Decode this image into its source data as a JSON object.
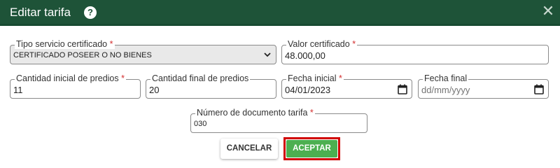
{
  "dialog": {
    "title": "Editar tarifa",
    "help_icon": "?",
    "close_icon": "✕"
  },
  "fields": {
    "tipo_servicio": {
      "label": "Tipo servicio certificado",
      "required": "*",
      "value": "CERTIFICADO POSEER O NO BIENES"
    },
    "valor_certificado": {
      "label": "Valor certificado",
      "required": "*",
      "value": "48.000,00"
    },
    "cantidad_inicial": {
      "label": "Cantidad inicial de predios",
      "required": "*",
      "value": "11"
    },
    "cantidad_final": {
      "label": "Cantidad final de predios",
      "value": "20"
    },
    "fecha_inicial": {
      "label": "Fecha inicial",
      "required": "*",
      "value": "04/01/2023"
    },
    "fecha_final": {
      "label": "Fecha final",
      "placeholder": "dd/mm/yyyy"
    },
    "numero_documento": {
      "label": "Número de documento tarifa",
      "required": "*",
      "value": "030"
    }
  },
  "buttons": {
    "cancel": "CANCELAR",
    "accept": "ACEPTAR"
  },
  "colors": {
    "header_bg": "#1e5338",
    "accept_bg": "#4caf50",
    "highlight": "#d10000",
    "required": "#d32f2f"
  }
}
